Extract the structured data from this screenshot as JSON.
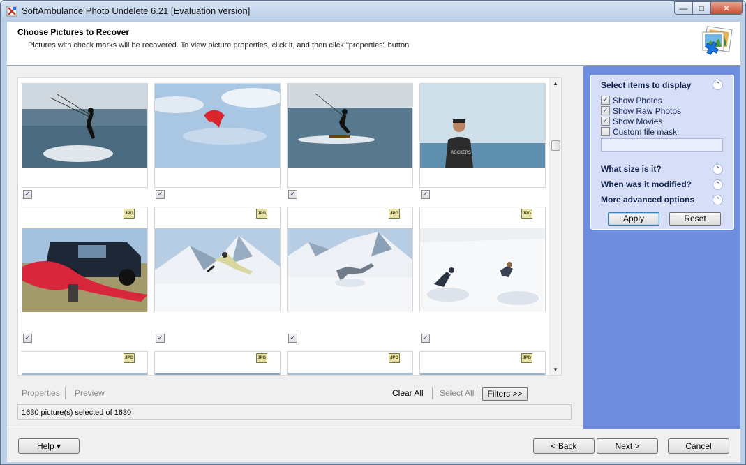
{
  "window": {
    "title": "SoftAmbulance Photo Undelete 6.21 [Evaluation version]",
    "buttons": [
      "minimize",
      "maximize",
      "close"
    ]
  },
  "header": {
    "title": "Choose Pictures to Recover",
    "subtitle": "Pictures with check marks will be recovered. To view picture properties, click it, and then click \"properties\" button"
  },
  "gallery": {
    "file_badge": "JPG",
    "rows": [
      [
        {
          "scene": "kitesurfer-jumping",
          "checked": true
        },
        {
          "scene": "kite-in-sky",
          "checked": true
        },
        {
          "scene": "kitesurfer-riding",
          "checked": true
        },
        {
          "scene": "man-at-beach",
          "checked": true
        }
      ],
      [
        {
          "scene": "kite-packing-near-car",
          "checked": true
        },
        {
          "scene": "snowboarder-jump",
          "checked": true
        },
        {
          "scene": "snowboarder-fall",
          "checked": true
        },
        {
          "scene": "skier-in-deep-snow",
          "checked": true
        }
      ]
    ]
  },
  "actions": {
    "properties": "Properties",
    "preview": "Preview",
    "clear_all": "Clear All",
    "select_all": "Select All",
    "filters": "Filters >>"
  },
  "status": {
    "text": "1630 picture(s) selected of 1630"
  },
  "side_panel": {
    "display_title": "Select items to display",
    "options": [
      {
        "label": "Show Photos",
        "checked": true
      },
      {
        "label": "Show Raw Photos",
        "checked": true
      },
      {
        "label": "Show Movies",
        "checked": true
      },
      {
        "label": "Custom file mask:",
        "checked": false
      }
    ],
    "mask_value": "",
    "sections": [
      "What size is it?",
      "When was it modified?",
      "More advanced options"
    ],
    "apply": "Apply",
    "reset": "Reset"
  },
  "footer": {
    "help": "Help ▾",
    "back": "< Back",
    "next": "Next >",
    "cancel": "Cancel"
  },
  "colors": {
    "side_bg": "#6e8ddc",
    "panel_bg": "#d6dff7",
    "titlebar": "#bcd0e8"
  }
}
